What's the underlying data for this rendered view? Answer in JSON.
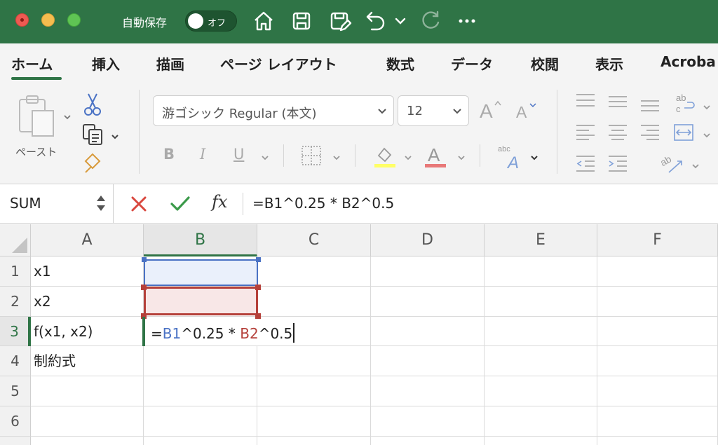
{
  "titlebar": {
    "autosave_label": "自動保存",
    "autosave_toggle": "オフ",
    "background": "#2f7446",
    "icons": [
      "home-icon",
      "save-icon",
      "save-edit-icon",
      "undo-icon",
      "undo-dropdown-icon",
      "redo-icon",
      "more-icon"
    ]
  },
  "tabs": [
    {
      "label": "ホーム",
      "active": true
    },
    {
      "label": "挿入"
    },
    {
      "label": "描画"
    },
    {
      "label": "ページ レイアウト"
    },
    {
      "label": "数式"
    },
    {
      "label": "データ"
    },
    {
      "label": "校閲"
    },
    {
      "label": "表示"
    },
    {
      "label": "Acroba"
    }
  ],
  "ribbon": {
    "paste_label": "ペースト",
    "font_name": "游ゴシック Regular (本文)",
    "font_size": "12",
    "bold": "B",
    "italic": "I",
    "underline": "U"
  },
  "formula_bar": {
    "name_box": "SUM",
    "fx": "fx",
    "formula": "=B1^0.25 * B2^0.5"
  },
  "grid": {
    "columns": [
      "A",
      "B",
      "C",
      "D",
      "E",
      "F"
    ],
    "rows": [
      "1",
      "2",
      "3",
      "4",
      "5",
      "6"
    ],
    "cells": {
      "A1": "x1",
      "A2": "x2",
      "A3": "f(x1, x2)",
      "A4": "制約式"
    },
    "editing": {
      "eq": "=",
      "ref1": "B1",
      "mid": "^0.25 * ",
      "ref2": "B2",
      "tail": "^0.5"
    }
  }
}
